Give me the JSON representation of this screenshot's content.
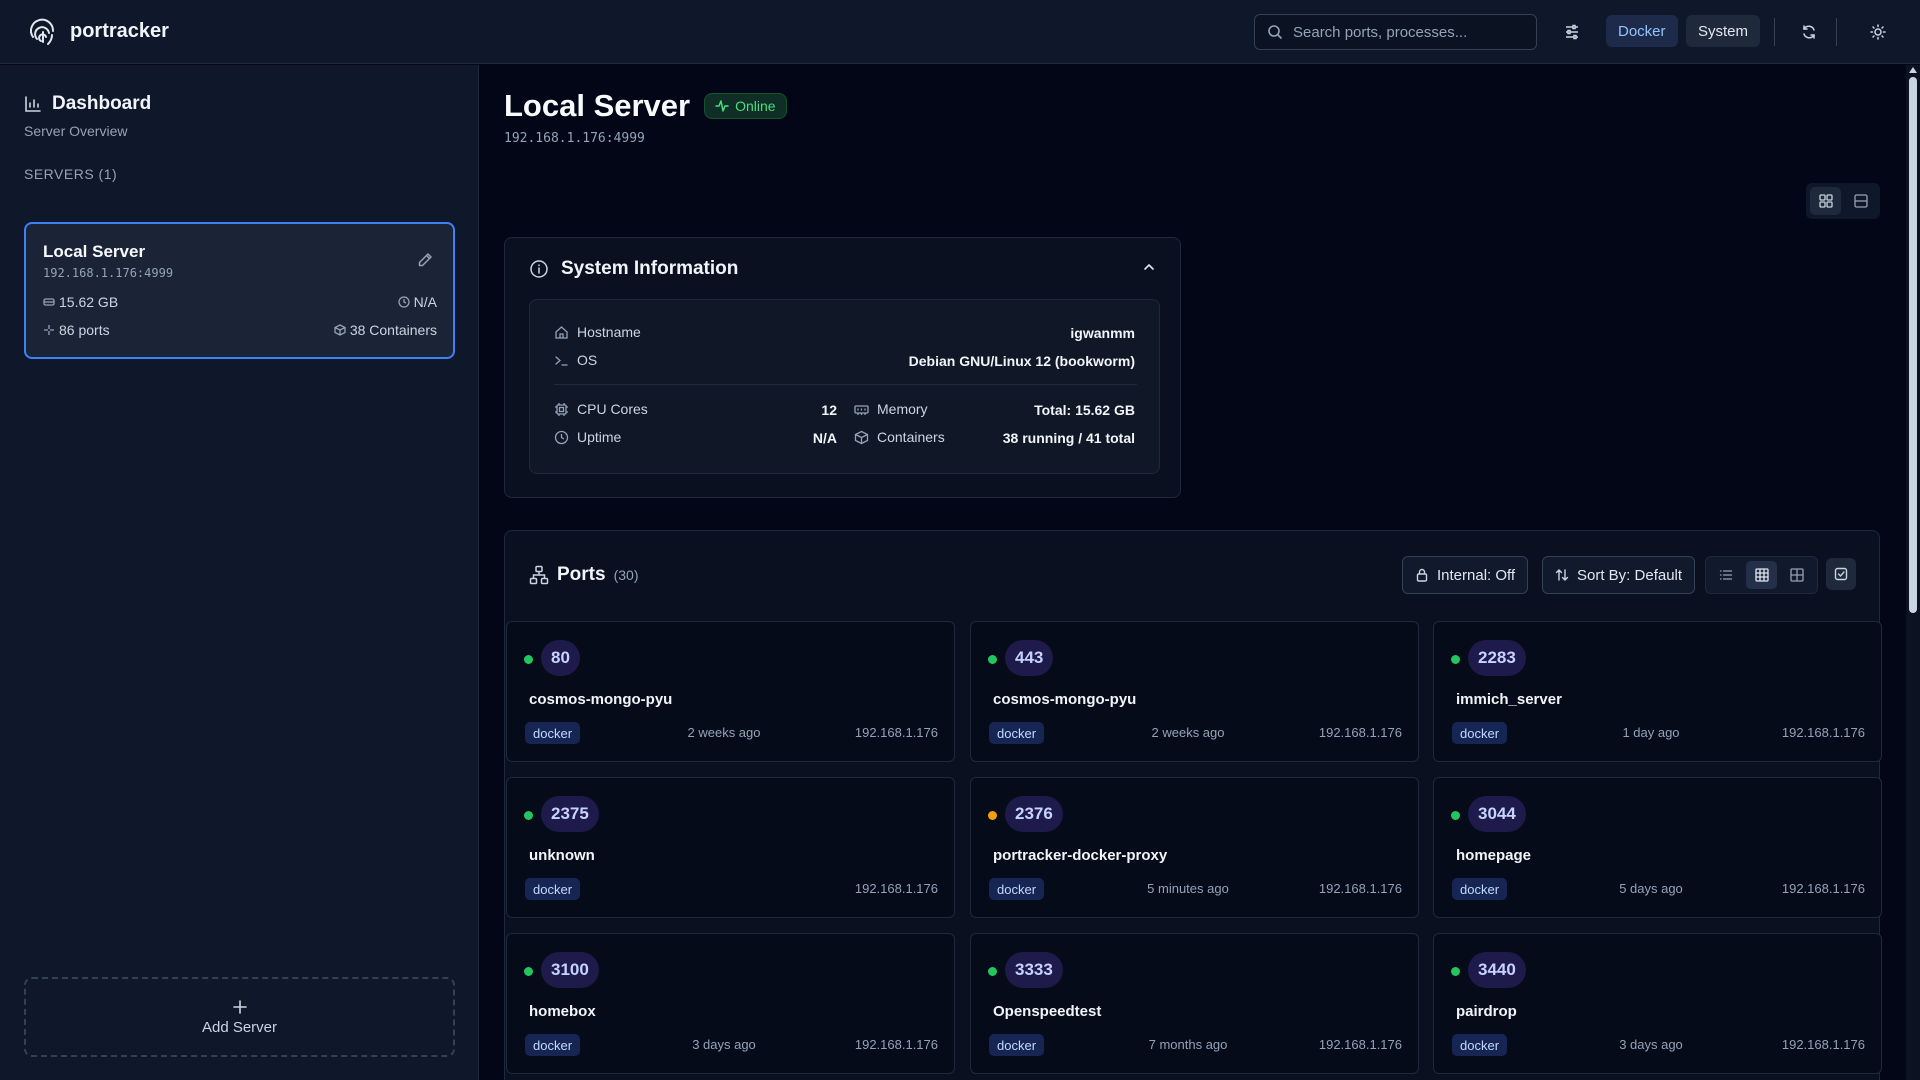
{
  "app": {
    "name": "portracker"
  },
  "search": {
    "placeholder": "Search ports, processes..."
  },
  "header": {
    "docker_label": "Docker",
    "system_label": "System"
  },
  "sidebar": {
    "title": "Dashboard",
    "subtitle": "Server Overview",
    "servers_heading": "SERVERS (1)",
    "server": {
      "name": "Local Server",
      "ip": "192.168.1.176:4999",
      "memory": "15.62 GB",
      "uptime": "N/A",
      "ports": "86 ports",
      "containers": "38 Containers"
    },
    "add_server_label": "Add Server"
  },
  "main": {
    "title": "Local Server",
    "status": "Online",
    "ip": "192.168.1.176:4999"
  },
  "system_info": {
    "title": "System Information",
    "hostname_label": "Hostname",
    "hostname": "igwanmm",
    "os_label": "OS",
    "os": "Debian GNU/Linux 12 (bookworm)",
    "cpu_label": "CPU Cores",
    "cpu": "12",
    "memory_label": "Memory",
    "memory": "Total: 15.62 GB",
    "uptime_label": "Uptime",
    "uptime": "N/A",
    "containers_label": "Containers",
    "containers": "38 running / 41 total"
  },
  "ports": {
    "title": "Ports",
    "count": "(30)",
    "internal_label": "Internal: Off",
    "sort_label": "Sort By: Default",
    "items": [
      {
        "port": "80",
        "name": "cosmos-mongo-pyu",
        "tag": "docker",
        "time": "2 weeks ago",
        "ip": "192.168.1.176",
        "status": "green"
      },
      {
        "port": "443",
        "name": "cosmos-mongo-pyu",
        "tag": "docker",
        "time": "2 weeks ago",
        "ip": "192.168.1.176",
        "status": "green"
      },
      {
        "port": "2283",
        "name": "immich_server",
        "tag": "docker",
        "time": "1 day ago",
        "ip": "192.168.1.176",
        "status": "green"
      },
      {
        "port": "2375",
        "name": "unknown",
        "tag": "docker",
        "time": "",
        "ip": "192.168.1.176",
        "status": "green"
      },
      {
        "port": "2376",
        "name": "portracker-docker-proxy",
        "tag": "docker",
        "time": "5 minutes ago",
        "ip": "192.168.1.176",
        "status": "amber"
      },
      {
        "port": "3044",
        "name": "homepage",
        "tag": "docker",
        "time": "5 days ago",
        "ip": "192.168.1.176",
        "status": "green"
      },
      {
        "port": "3100",
        "name": "homebox",
        "tag": "docker",
        "time": "3 days ago",
        "ip": "192.168.1.176",
        "status": "green"
      },
      {
        "port": "3333",
        "name": "Openspeedtest",
        "tag": "docker",
        "time": "7 months ago",
        "ip": "192.168.1.176",
        "status": "green"
      },
      {
        "port": "3440",
        "name": "pairdrop",
        "tag": "docker",
        "time": "3 days ago",
        "ip": "192.168.1.176",
        "status": "green"
      }
    ]
  },
  "colors": {
    "green": "#22c55e",
    "amber": "#f59e0b",
    "accent": "#3b82f6"
  }
}
